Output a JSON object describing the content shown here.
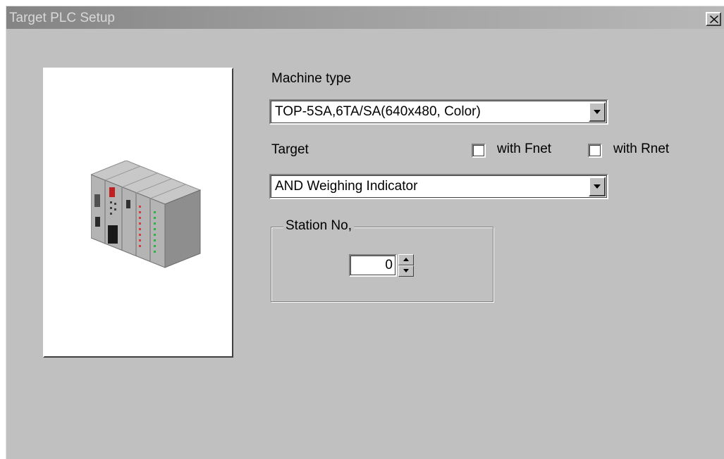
{
  "window": {
    "title": "Target PLC Setup"
  },
  "icons": {
    "close": "close-icon",
    "preview": "plc-rack-icon",
    "dropdown": "chevron-down-icon",
    "spin_up": "arrow-up-icon",
    "spin_down": "arrow-down-icon"
  },
  "machine_type": {
    "label": "Machine type",
    "value": "TOP-5SA,6TA/SA(640x480, Color)"
  },
  "target": {
    "label": "Target",
    "value": "AND Weighing Indicator",
    "with_fnet": {
      "label": "with Fnet",
      "checked": false
    },
    "with_rnet": {
      "label": "with Rnet",
      "checked": false
    }
  },
  "station": {
    "label": "Station No,",
    "value": "0"
  }
}
